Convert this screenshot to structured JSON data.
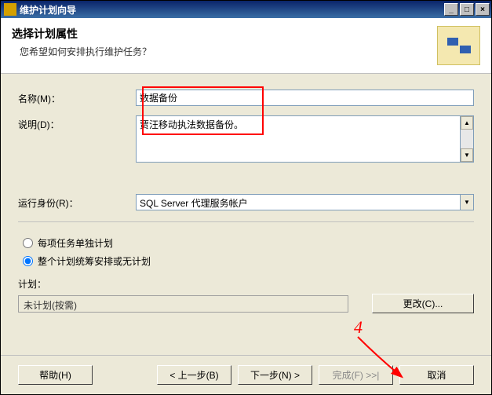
{
  "titlebar": {
    "title": "维护计划向导"
  },
  "header": {
    "title": "选择计划属性",
    "subtitle": "您希望如何安排执行维护任务？"
  },
  "form": {
    "name_label": "名称(M)：",
    "name_value": "数据备份",
    "desc_label": "说明(D)：",
    "desc_value": "贾汪移动执法数据备份。",
    "runas_label": "运行身份(R)：",
    "runas_value": "SQL Server 代理服务帐户"
  },
  "radio": {
    "opt1": "每项任务单独计划",
    "opt2": "整个计划统筹安排或无计划"
  },
  "plan": {
    "label": "计划：",
    "value": "未计划(按需)",
    "change_btn": "更改(C)..."
  },
  "footer": {
    "help": "帮助(H)",
    "back": "< 上一步(B)",
    "next": "下一步(N) >",
    "finish": "完成(F) >>|",
    "cancel": "取消"
  },
  "annotation": {
    "num": "4"
  }
}
